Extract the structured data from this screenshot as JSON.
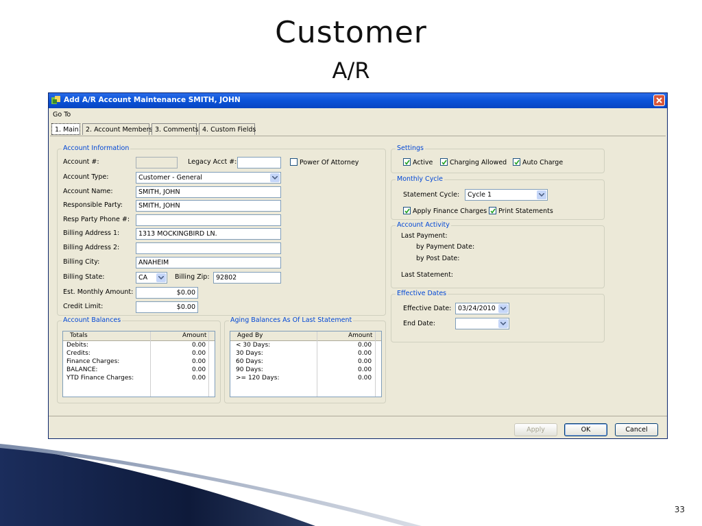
{
  "slide": {
    "title": "Customer",
    "subtitle": "A/R",
    "page_number": "33"
  },
  "window": {
    "title": "Add A/R Account Maintenance SMITH, JOHN",
    "menu": [
      "Go To"
    ],
    "tabs": [
      "1. Main",
      "2. Account Members",
      "3. Comments",
      "4. Custom Fields"
    ],
    "buttons": {
      "apply": "Apply",
      "ok": "OK",
      "cancel": "Cancel"
    }
  },
  "account_info": {
    "title": "Account Information",
    "account_no_label": "Account #:",
    "account_no": "",
    "legacy_label": "Legacy Acct #:",
    "legacy_value": "",
    "poa_label": "Power Of Attorney",
    "poa_checked": false,
    "type_label": "Account Type:",
    "type_value": "Customer - General",
    "name_label": "Account Name:",
    "name_value": "SMITH, JOHN",
    "resp_label": "Responsible Party:",
    "resp_value": "SMITH, JOHN",
    "phone_label": "Resp Party Phone #:",
    "phone_value": "",
    "addr1_label": "Billing Address 1:",
    "addr1_value": "1313 MOCKINGBIRD LN.",
    "addr2_label": "Billing Address 2:",
    "addr2_value": "",
    "city_label": "Billing City:",
    "city_value": "ANAHEIM",
    "state_label": "Billing State:",
    "state_value": "CA",
    "zip_label": "Billing Zip:",
    "zip_value": "92802",
    "monthly_label": "Est. Monthly Amount:",
    "monthly_value": "$0.00",
    "credit_label": "Credit Limit:",
    "credit_value": "$0.00"
  },
  "settings": {
    "title": "Settings",
    "active": {
      "label": "Active",
      "checked": true
    },
    "charging": {
      "label": "Charging Allowed",
      "checked": true
    },
    "auto": {
      "label": "Auto Charge",
      "checked": true
    }
  },
  "monthly_cycle": {
    "title": "Monthly Cycle",
    "cycle_label": "Statement Cycle:",
    "cycle_value": "Cycle 1",
    "finance": {
      "label": "Apply Finance Charges",
      "checked": true
    },
    "print": {
      "label": "Print Statements",
      "checked": true
    }
  },
  "account_activity": {
    "title": "Account Activity",
    "last_payment": "Last Payment:",
    "by_payment_date": "by Payment Date:",
    "by_post_date": "by Post Date:",
    "last_statement": "Last Statement:"
  },
  "effective_dates": {
    "title": "Effective Dates",
    "effective_label": "Effective Date:",
    "effective_value": "03/24/2010",
    "end_label": "End Date:",
    "end_value": ""
  },
  "account_balances": {
    "title": "Account Balances",
    "headers": [
      "Totals",
      "Amount"
    ],
    "rows": [
      [
        "Debits:",
        "0.00"
      ],
      [
        "Credits:",
        "0.00"
      ],
      [
        "Finance Charges:",
        "0.00"
      ],
      [
        "BALANCE:",
        "0.00"
      ],
      [
        "YTD Finance Charges:",
        "0.00"
      ]
    ]
  },
  "aging": {
    "title": "Aging Balances As Of Last Statement",
    "headers": [
      "Aged By",
      "Amount"
    ],
    "rows": [
      [
        "< 30 Days:",
        "0.00"
      ],
      [
        "30 Days:",
        "0.00"
      ],
      [
        "60 Days:",
        "0.00"
      ],
      [
        "90 Days:",
        "0.00"
      ],
      [
        ">= 120 Days:",
        "0.00"
      ]
    ]
  }
}
